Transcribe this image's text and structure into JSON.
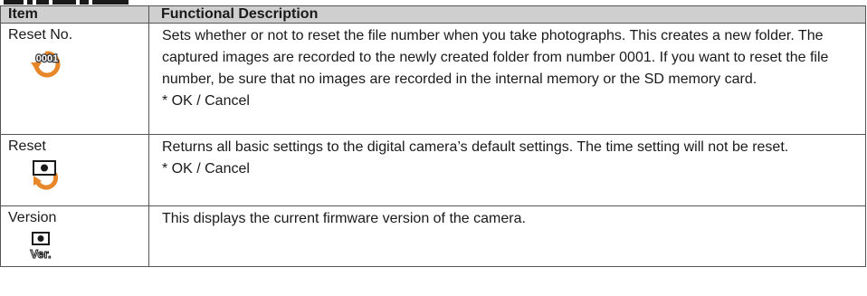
{
  "header": {
    "item": "Item",
    "description": "Functional Description"
  },
  "rows": [
    {
      "item": "Reset No.",
      "icon": "reset-number-icon",
      "icon_text": "0001",
      "description": "Sets whether or not to reset the file number when you take photographs. This creates a new folder. The captured images are recorded to the newly created folder from number 0001. If you want to reset the file number, be sure that no images are recorded in the internal memory or the SD memory card.",
      "option": "* OK / Cancel"
    },
    {
      "item": "Reset",
      "icon": "reset-camera-icon",
      "description": "Returns all basic settings to the digital camera’s default settings. The time setting will not be reset.",
      "option": "* OK / Cancel"
    },
    {
      "item": "Version",
      "icon": "version-icon",
      "icon_text": "Ver.",
      "description": "This displays the current firmware version of the camera."
    }
  ],
  "colors": {
    "header_bg": "#cfcfcf",
    "border": "#555555",
    "icon_orange": "#e8872a"
  }
}
